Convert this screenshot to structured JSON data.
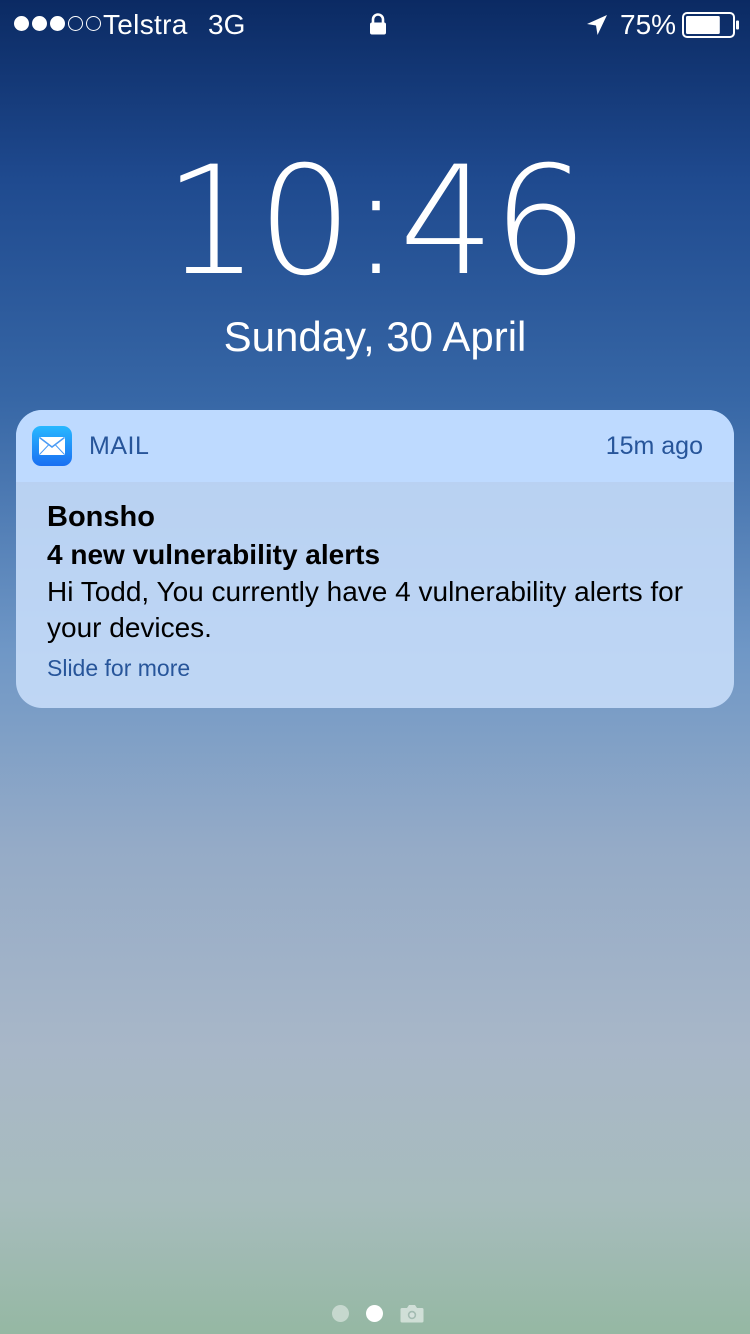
{
  "status_bar": {
    "signal_bars_full": 3,
    "signal_bars_total": 5,
    "carrier": "Telstra",
    "network": "3G",
    "lock_icon": "lock-icon",
    "location_icon": "location-arrow-icon",
    "battery_percent_label": "75%",
    "battery_level": 0.75
  },
  "lock_screen": {
    "time": "10:46",
    "date": "Sunday, 30 April"
  },
  "notification": {
    "app_icon": "mail-icon",
    "app_name": "MAIL",
    "time_ago": "15m ago",
    "sender": "Bonsho",
    "subject": "4 new vulnerability alerts",
    "preview": "Hi Todd, You currently have 4 vulnerability alerts for your devices.",
    "action_hint": "Slide for more"
  },
  "page_indicator": {
    "pages": 2,
    "active_page": 2,
    "camera_icon": "camera-icon"
  },
  "colors": {
    "notification_accent": "#27559a",
    "mail_icon_top": "#28b8ff",
    "mail_icon_bottom": "#1a6ff2"
  }
}
